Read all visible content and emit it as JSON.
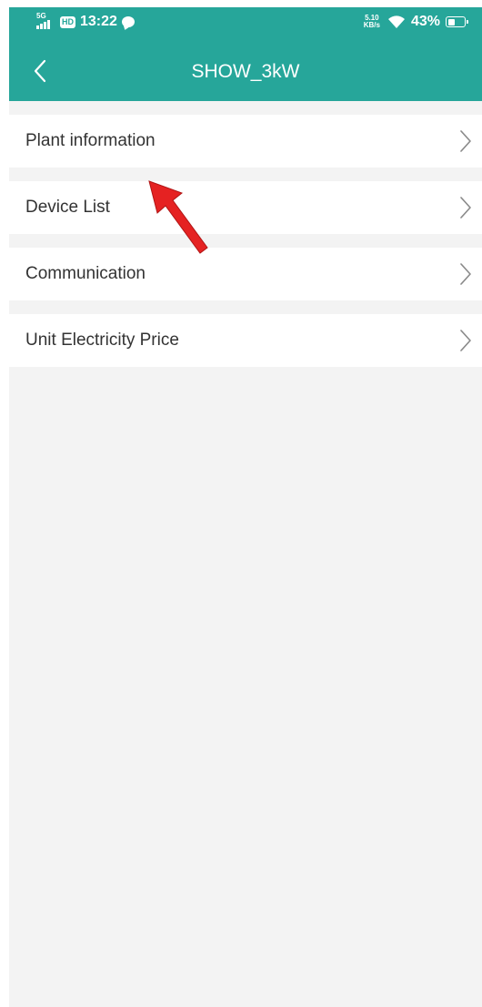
{
  "status_bar": {
    "network_type": "5G",
    "hd_label": "HD",
    "time": "13:22",
    "speed_value": "5.10",
    "speed_unit": "KB/s",
    "battery_percent": "43%",
    "battery_level": 0.43
  },
  "header": {
    "title": "SHOW_3kW",
    "background_color": "#26a69a"
  },
  "menu": {
    "items": [
      {
        "label": "Plant information"
      },
      {
        "label": "Device List"
      },
      {
        "label": "Communication"
      },
      {
        "label": "Unit Electricity Price"
      }
    ]
  },
  "icons": {
    "back": "chevron-left-icon",
    "item_arrow": "chevron-right-icon",
    "annotation": "red-arrow-annotation",
    "annotation_color": "#e52222"
  }
}
